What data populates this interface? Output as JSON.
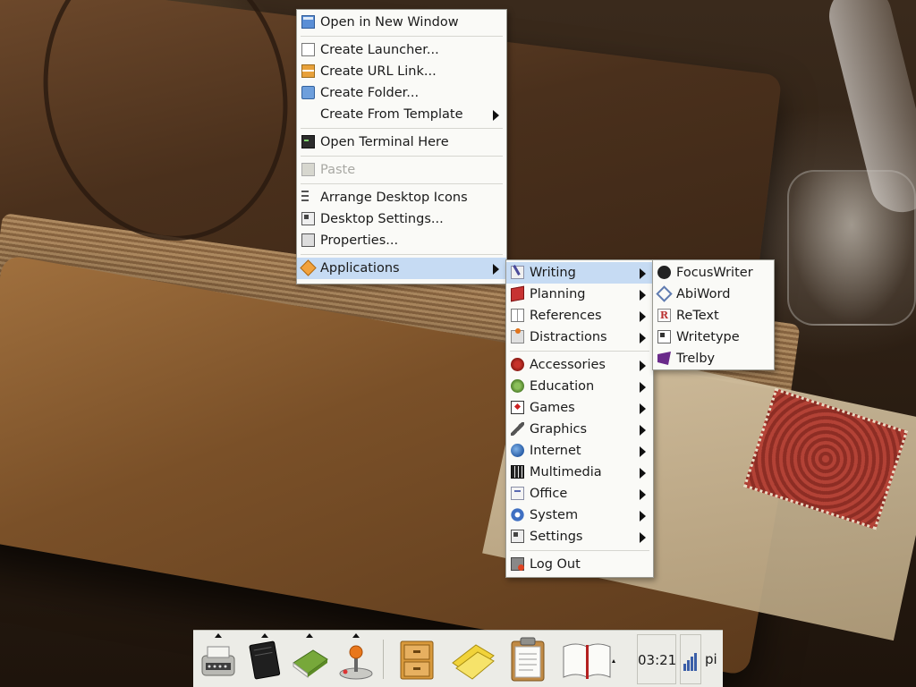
{
  "desktop_menu": {
    "items": [
      {
        "label": "Open in New Window",
        "icon": "window-icon"
      },
      {
        "label": "Create Launcher...",
        "icon": "launcher-icon"
      },
      {
        "label": "Create URL Link...",
        "icon": "link-icon"
      },
      {
        "label": "Create Folder...",
        "icon": "folder-icon"
      },
      {
        "label": "Create From Template",
        "icon": "none"
      },
      {
        "label": "Open Terminal Here",
        "icon": "terminal-icon"
      },
      {
        "label": "Paste",
        "icon": "paste-icon",
        "disabled": true
      },
      {
        "label": "Arrange Desktop Icons",
        "icon": "arrange-icon"
      },
      {
        "label": "Desktop Settings...",
        "icon": "settings-icon"
      },
      {
        "label": "Properties...",
        "icon": "properties-icon"
      },
      {
        "label": "Applications",
        "icon": "applications-icon",
        "active": true
      }
    ]
  },
  "applications_menu": {
    "items": [
      {
        "label": "Writing",
        "icon": "writing-icon",
        "active": true
      },
      {
        "label": "Planning",
        "icon": "planning-icon"
      },
      {
        "label": "References",
        "icon": "references-icon"
      },
      {
        "label": "Distractions",
        "icon": "distractions-icon"
      },
      {
        "label": "Accessories",
        "icon": "accessories-icon"
      },
      {
        "label": "Education",
        "icon": "education-icon"
      },
      {
        "label": "Games",
        "icon": "games-icon"
      },
      {
        "label": "Graphics",
        "icon": "graphics-icon"
      },
      {
        "label": "Internet",
        "icon": "internet-icon"
      },
      {
        "label": "Multimedia",
        "icon": "multimedia-icon"
      },
      {
        "label": "Office",
        "icon": "office-icon"
      },
      {
        "label": "System",
        "icon": "system-icon"
      },
      {
        "label": "Settings",
        "icon": "settings-icon"
      },
      {
        "label": "Log Out",
        "icon": "logout-icon"
      }
    ]
  },
  "writing_menu": {
    "items": [
      {
        "label": "FocusWriter",
        "icon": "focuswriter-icon"
      },
      {
        "label": "AbiWord",
        "icon": "abiword-icon"
      },
      {
        "label": "ReText",
        "icon": "retext-icon",
        "glyph": "R"
      },
      {
        "label": "Writetype",
        "icon": "writetype-icon"
      },
      {
        "label": "Trelby",
        "icon": "trelby-icon"
      }
    ]
  },
  "panel": {
    "launchers": [
      "typewriter-icon",
      "notebook-icon",
      "green-book-icon",
      "joystick-icon"
    ],
    "apps": [
      "file-cabinet-icon",
      "sticky-notes-icon",
      "clipboard-icon",
      "open-book-icon"
    ],
    "clock": "03:21",
    "user": "pi"
  },
  "colors": {
    "menu_bg": "#fafaf7",
    "highlight": "#c6dbf3",
    "panel_bg": "#ecece7"
  }
}
